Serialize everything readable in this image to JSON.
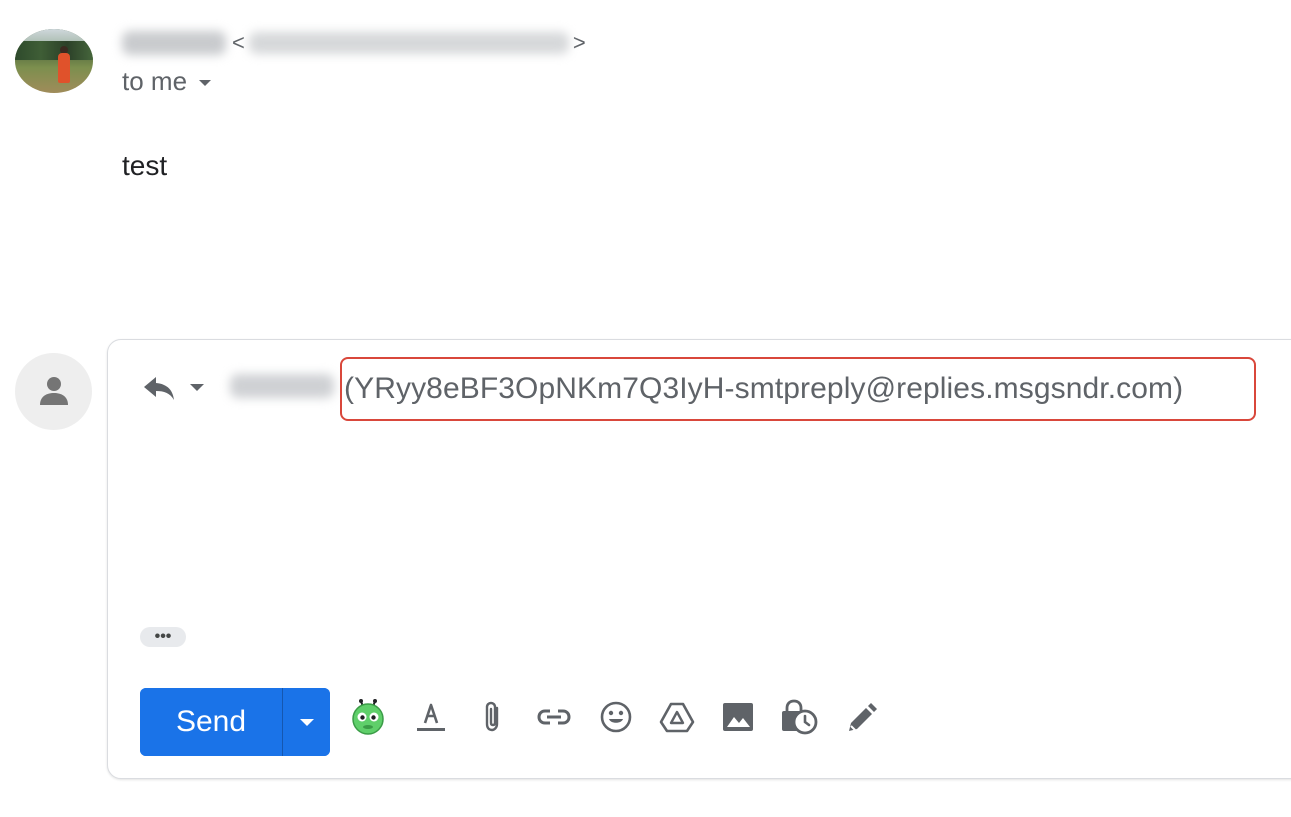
{
  "message": {
    "sender_open": "<",
    "sender_close": ">",
    "recipient_label": "to me",
    "body": "test"
  },
  "reply": {
    "recipient_address": "(YRyy8eBF3OpNKm7Q3IyH-smtpreply@replies.msgsndr.com)",
    "trimmed_content": "•••",
    "send_label": "Send"
  },
  "toolbar": {
    "icons": [
      "bot-extension-icon",
      "formatting-options-icon",
      "attach-files-icon",
      "insert-link-icon",
      "insert-emoji-icon",
      "google-drive-icon",
      "insert-photo-icon",
      "confidential-mode-icon",
      "signature-icon"
    ]
  },
  "colors": {
    "send_button": "#1a73e8",
    "highlight_outline": "#d9473b",
    "icon_gray": "#5f6368"
  }
}
